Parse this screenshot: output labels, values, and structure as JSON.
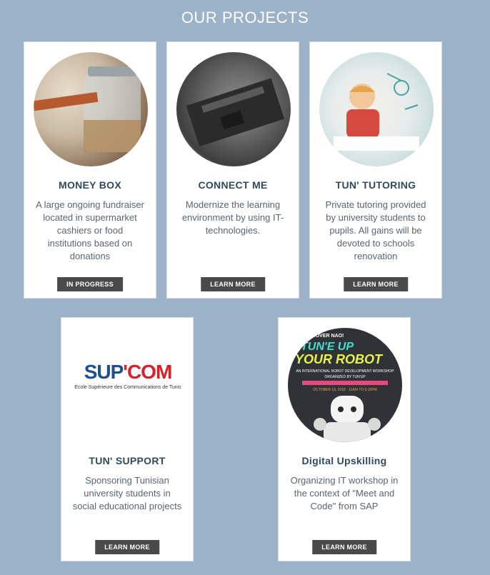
{
  "section": {
    "title": "OUR PROJECTS"
  },
  "projects": [
    {
      "title": "MONEY BOX",
      "description": "A large ongoing fundraiser located in supermarket cashiers or food institutions based on donations",
      "button": "IN PROGRESS",
      "image": "coin-jar-photo"
    },
    {
      "title": "CONNECT ME",
      "description": "Modernize the learning environment by using IT-technologies.",
      "button": "LEARN MORE",
      "image": "circuit-board-photo"
    },
    {
      "title": "TUN' TUTORING",
      "description": "Private tutoring provided by university students to pupils. All gains will be devoted to schools renovation",
      "button": "LEARN MORE",
      "image": "child-studying-photo"
    },
    {
      "title": "TUN' SUPPORT",
      "description": "Sponsoring Tunisian university students in social educational projects",
      "button": "LEARN MORE",
      "image": "supcom-logo",
      "logo": {
        "part1": "SUP",
        "part2": "'COM",
        "subtitle": "Ecole Supérieure des Communications de Tunis"
      }
    },
    {
      "title": "Digital Upskilling",
      "description": "Organizing IT workshop in the context of \"Meet and Code\" from SAP",
      "button": "LEARN MORE",
      "image": "robot-workshop-poster",
      "poster": {
        "kicker": "DISCOVER NAO!",
        "headline1": "TUN'E UP",
        "headline2": "YOUR ROBOT",
        "tagline": "AN INTERNATIONAL ROBOT DEVELOPMENT WORKSHOP",
        "organizer": "ORGANIZED BY TUN'UP",
        "date": "OCTOBER 13, 2018 · 11AM TO 5:15PM"
      }
    }
  ],
  "colors": {
    "background": "#9bb2c9",
    "card": "#ffffff",
    "title": "#2f4a5e",
    "button": "#4a4a4a",
    "supcom_blue": "#1f4e8c",
    "supcom_red": "#d6202a"
  }
}
